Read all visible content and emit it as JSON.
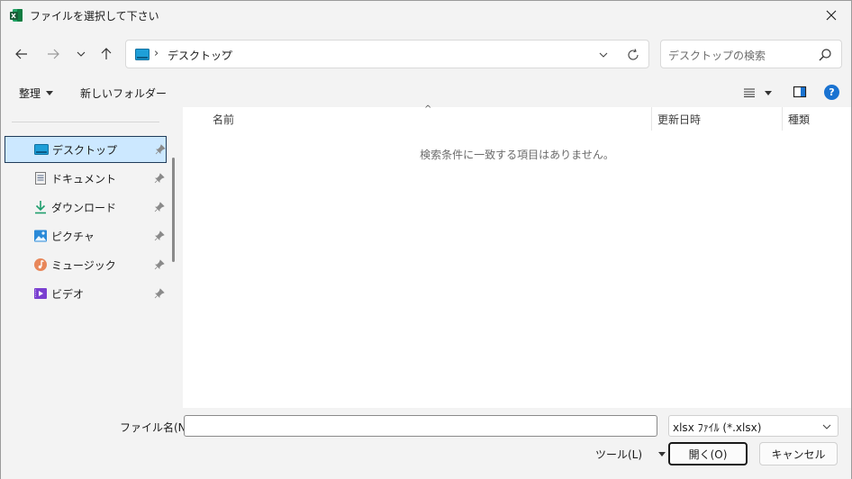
{
  "window": {
    "title": "ファイルを選択して下さい",
    "icons": {
      "app": "excel-app-icon",
      "close": "close-icon"
    }
  },
  "nav": {
    "icons": [
      "back-arrow-icon",
      "forward-arrow-icon",
      "recent-chevron-icon",
      "up-arrow-icon"
    ],
    "address": {
      "current": "デスクトップ",
      "icon": "desktop-icon"
    },
    "search_placeholder": "デスクトップの検索"
  },
  "commands": {
    "organize": "整理",
    "new_folder": "新しいフォルダー",
    "help": "?"
  },
  "sidebar": {
    "items": [
      {
        "label": "デスクトップ",
        "icon": "desktop-icon",
        "selected": true
      },
      {
        "label": "ドキュメント",
        "icon": "document-icon",
        "selected": false
      },
      {
        "label": "ダウンロード",
        "icon": "download-icon",
        "selected": false
      },
      {
        "label": "ピクチャ",
        "icon": "picture-icon",
        "selected": false
      },
      {
        "label": "ミュージック",
        "icon": "music-icon",
        "selected": false
      },
      {
        "label": "ビデオ",
        "icon": "video-icon",
        "selected": false
      }
    ]
  },
  "list": {
    "columns": [
      "名前",
      "更新日時",
      "種類"
    ],
    "empty_message": "検索条件に一致する項目はありません。"
  },
  "footer": {
    "filename_label": "ファイル名(N):",
    "filename_value": "",
    "filetype": "xlsx ﾌｧｲﾙ (*.xlsx)",
    "tools": "ツール(L)",
    "open": "開く(O)",
    "cancel": "キャンセル"
  },
  "colors": {
    "selection": "#cce8ff",
    "help": "#1a73d1"
  }
}
